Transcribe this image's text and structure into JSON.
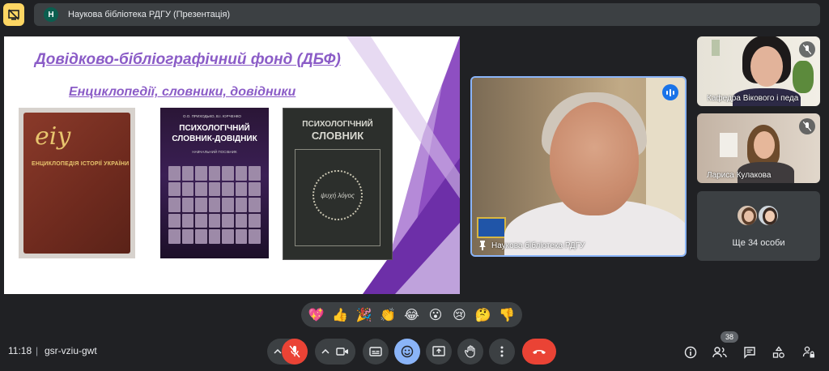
{
  "presenter": {
    "initial": "Н",
    "label": "Наукова бібліотека РДГУ (Презентація)"
  },
  "slide": {
    "title": "Довідково-бібліографічний фонд (ДБФ)",
    "subtitle": "Енциклопедії, словники, довідники",
    "books": [
      {
        "logo": "eiy",
        "title": "ЕНЦИКЛОПЕДІЯ ІСТОРІЇ УКРАЇНИ"
      },
      {
        "authors": "О.О. ПРИХОДЬКО, В.І. ЮРЧЕНКО",
        "title_line1": "ПСИХОЛОГІЧНИЙ",
        "title_line2": "СЛОВНИК-ДОВІДНИК",
        "note": "НАВЧАЛЬНИЙ ПОСІБНИК"
      },
      {
        "title_line1": "ПСИХОЛОГІЧНИЙ",
        "title_line2": "СЛОВНИК",
        "emblem": "ψυχή λόγος"
      }
    ]
  },
  "main_tile": {
    "name": "Наукова бібліотека РДГУ"
  },
  "side_tiles": [
    {
      "name": "Кафедра Вікового і педа"
    },
    {
      "name": "Лариса Кулакова"
    }
  ],
  "more_tile": {
    "label": "Ще 34 особи"
  },
  "reactions": [
    "💖",
    "👍",
    "🎉",
    "👏",
    "😂",
    "😮",
    "😢",
    "🤔",
    "👎"
  ],
  "bottom": {
    "time": "11:18",
    "separator": "|",
    "meeting_code": "gsr-vziu-gwt",
    "participant_count": "38"
  },
  "colors": {
    "background": "#202124",
    "surface": "#3c4043",
    "accent": "#8ab4f8",
    "mic_off": "#ea4335",
    "hang_up": "#ea4335",
    "emoji_active": "#8ab4f8",
    "warning": "#fdd663",
    "slide_title": "#8b5cc7"
  }
}
